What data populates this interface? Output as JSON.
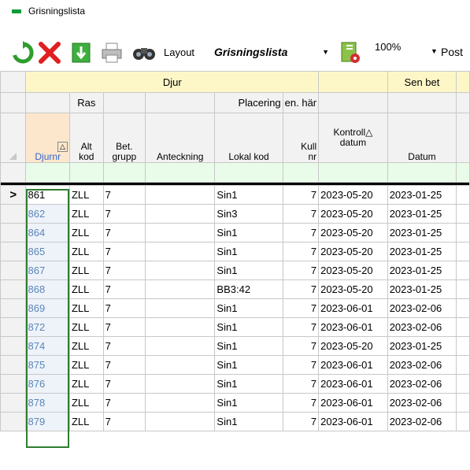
{
  "window": {
    "title": "Grisningslista"
  },
  "toolbar": {
    "refresh_icon": "refresh-icon",
    "delete_icon": "delete-icon",
    "export_icon": "export-icon",
    "print_icon": "print-icon",
    "find_icon": "binoculars-icon",
    "layout_label": "Layout",
    "layout_value": "Grisningslista",
    "zoom": "100%",
    "post_label": "Post"
  },
  "grid": {
    "bands": {
      "djur": "Djur",
      "sen_bet": "Sen bet"
    },
    "subheaders": {
      "ras": "Ras",
      "placering": "Placering",
      "en_har": "en. här"
    },
    "columns": {
      "djurnr": "Djurnr",
      "altkod_1": "Alt",
      "altkod_2": "kod",
      "betgrupp_1": "Bet.",
      "betgrupp_2": "grupp",
      "anteckning": "Anteckning",
      "lokalkod": "Lokal kod",
      "kullnr_1": "Kull",
      "kullnr_2": "nr",
      "kontroll_1": "Kontroll",
      "kontroll_2": "datum",
      "datum": "Datum"
    },
    "sort_indicator": "△",
    "current_row_marker": ">",
    "rows": [
      {
        "djurnr": "861",
        "ras": "ZLL",
        "bet": "7",
        "anteckning": "",
        "lokal": "Sin1",
        "kull": "7",
        "kontroll": "2023-05-20",
        "datum": "2023-01-25"
      },
      {
        "djurnr": "862",
        "ras": "ZLL",
        "bet": "7",
        "anteckning": "",
        "lokal": "Sin3",
        "kull": "7",
        "kontroll": "2023-05-20",
        "datum": "2023-01-25"
      },
      {
        "djurnr": "864",
        "ras": "ZLL",
        "bet": "7",
        "anteckning": "",
        "lokal": "Sin1",
        "kull": "7",
        "kontroll": "2023-05-20",
        "datum": "2023-01-25"
      },
      {
        "djurnr": "865",
        "ras": "ZLL",
        "bet": "7",
        "anteckning": "",
        "lokal": "Sin1",
        "kull": "7",
        "kontroll": "2023-05-20",
        "datum": "2023-01-25"
      },
      {
        "djurnr": "867",
        "ras": "ZLL",
        "bet": "7",
        "anteckning": "",
        "lokal": "Sin1",
        "kull": "7",
        "kontroll": "2023-05-20",
        "datum": "2023-01-25"
      },
      {
        "djurnr": "868",
        "ras": "ZLL",
        "bet": "7",
        "anteckning": "",
        "lokal": "BB3:42",
        "kull": "7",
        "kontroll": "2023-05-20",
        "datum": "2023-01-25"
      },
      {
        "djurnr": "869",
        "ras": "ZLL",
        "bet": "7",
        "anteckning": "",
        "lokal": "Sin1",
        "kull": "7",
        "kontroll": "2023-06-01",
        "datum": "2023-02-06"
      },
      {
        "djurnr": "872",
        "ras": "ZLL",
        "bet": "7",
        "anteckning": "",
        "lokal": "Sin1",
        "kull": "7",
        "kontroll": "2023-06-01",
        "datum": "2023-02-06"
      },
      {
        "djurnr": "874",
        "ras": "ZLL",
        "bet": "7",
        "anteckning": "",
        "lokal": "Sin1",
        "kull": "7",
        "kontroll": "2023-05-20",
        "datum": "2023-01-25"
      },
      {
        "djurnr": "875",
        "ras": "ZLL",
        "bet": "7",
        "anteckning": "",
        "lokal": "Sin1",
        "kull": "7",
        "kontroll": "2023-06-01",
        "datum": "2023-02-06"
      },
      {
        "djurnr": "876",
        "ras": "ZLL",
        "bet": "7",
        "anteckning": "",
        "lokal": "Sin1",
        "kull": "7",
        "kontroll": "2023-06-01",
        "datum": "2023-02-06"
      },
      {
        "djurnr": "878",
        "ras": "ZLL",
        "bet": "7",
        "anteckning": "",
        "lokal": "Sin1",
        "kull": "7",
        "kontroll": "2023-06-01",
        "datum": "2023-02-06"
      },
      {
        "djurnr": "879",
        "ras": "ZLL",
        "bet": "7",
        "anteckning": "",
        "lokal": "Sin1",
        "kull": "7",
        "kontroll": "2023-06-01",
        "datum": "2023-02-06"
      }
    ]
  }
}
